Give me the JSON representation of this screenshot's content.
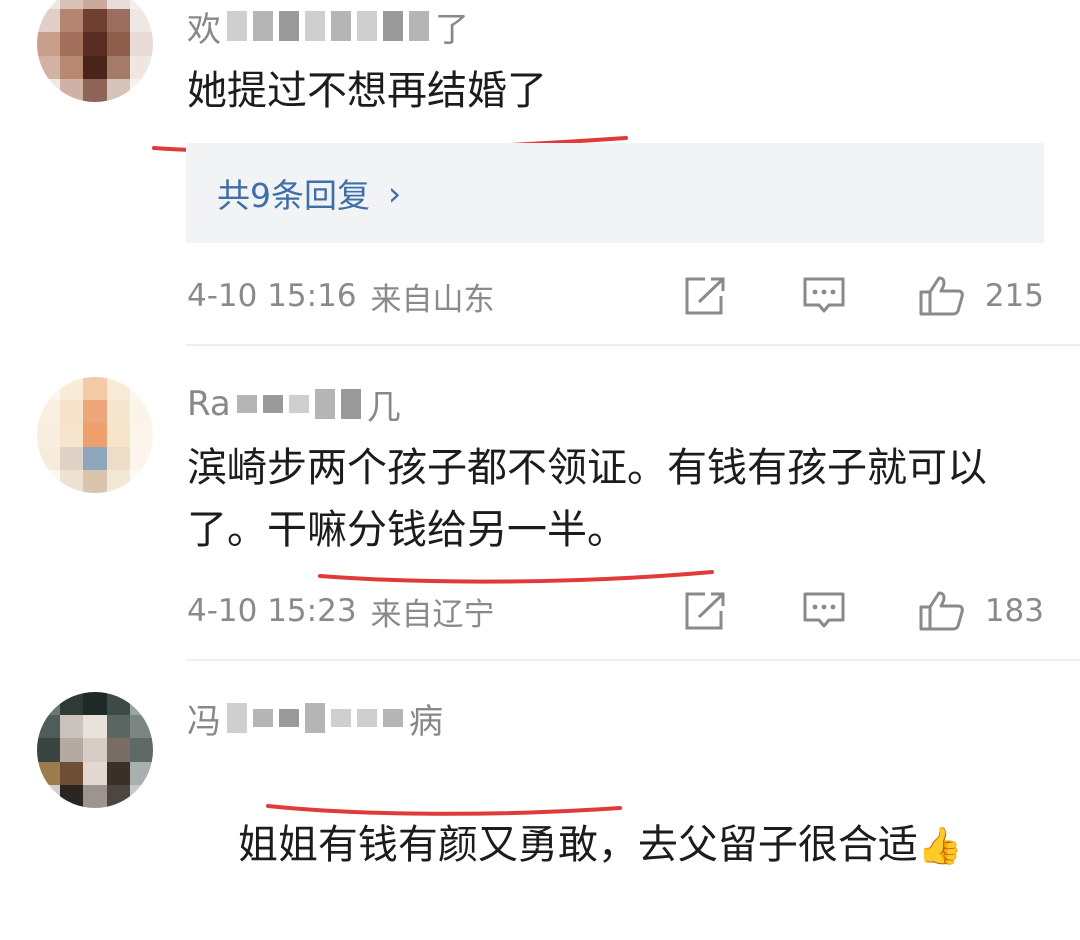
{
  "comments": [
    {
      "username_visible": "欢",
      "username_tail": "了",
      "content": "她提过不想再结婚了",
      "replies_label": "共9条回复",
      "time": "4-10 15:16",
      "location": "来自山东",
      "likes": "215"
    },
    {
      "username_visible": "Ra",
      "username_tail": "几",
      "content": "滨崎步两个孩子都不领证。有钱有孩子就可以了。干嘛分钱给另一半。",
      "time": "4-10 15:23",
      "location": "来自辽宁",
      "likes": "183"
    },
    {
      "username_visible": "冯",
      "username_tail": "病",
      "content": "姐姐有钱有颜又勇敢，去父留子很合适",
      "emoji": "👍"
    }
  ],
  "icons": [
    "share-icon",
    "comment-icon",
    "like-icon",
    "chevron-right-icon"
  ],
  "colors": {
    "link": "#3f6fa8",
    "meta": "#8a8a8a",
    "underline": "#e03a3a",
    "reply_bg": "#f2f3f5"
  }
}
